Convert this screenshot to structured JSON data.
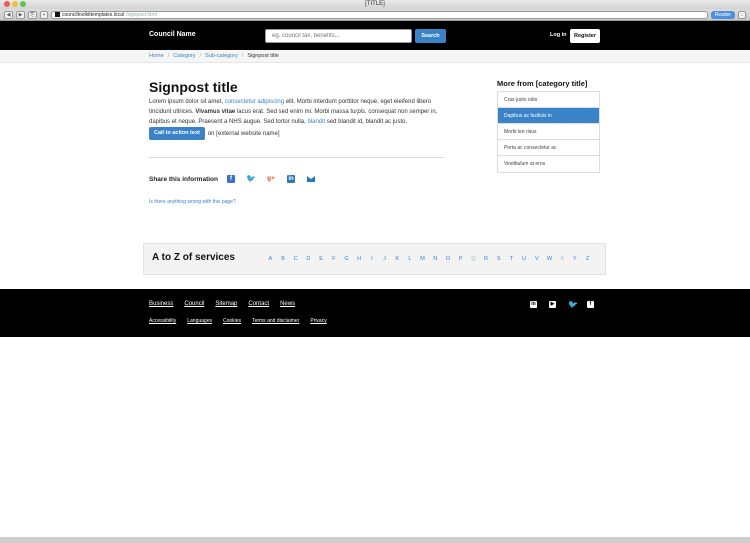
{
  "browser": {
    "window_title": "[TITLE]",
    "url_host": "counciltoolkittemplates.local",
    "url_path": "/signpost.html",
    "reader_label": "Reader",
    "back_glyph": "◀",
    "forward_glyph": "▶",
    "share_glyph": "⎘",
    "plus_glyph": "+",
    "download_glyph": "↓"
  },
  "header": {
    "brand": "Council Name",
    "search_placeholder": "eg. council tax, benefits...",
    "search_button": "Search",
    "login": "Log in",
    "register": "Register"
  },
  "breadcrumb": {
    "items": [
      "Home",
      "Category",
      "Sub-category"
    ],
    "separator": "/",
    "current": "Signpost title"
  },
  "main": {
    "title": "Signpost title",
    "intro": {
      "p1": "Lorem ipsum dolor sit amet, ",
      "link1": "consectetur adipiscing",
      "p2": " elit. Morbi interdum porttitor neque, eget eleifend libero tincidunt ultrices. ",
      "bold": "Vivamus vitae",
      "p3": " lacus erat. Sed sed enim mi. Morbi massa ",
      "italic": "turpis",
      "p4": ", consequat non semper in, dapibus et neque. Praesent a NHS augue. Sed tortor nulla, ",
      "link2": "blandit",
      "p5": " sed blandit id, blandit ac justo."
    },
    "cta_label": "Call to action text",
    "cta_suffix": "on [external website name]",
    "share_label": "Share this information",
    "share_icons": {
      "facebook": "f",
      "twitter": "🐦",
      "googleplus": "g+",
      "linkedin": "in"
    },
    "report_link": "Is there anything wrong with this page?"
  },
  "sidebar": {
    "title": "More from [category title]",
    "items": [
      "Cras justo odio",
      "Dapibus ac facilisis in",
      "Morbi leo risus",
      "Porta ac consectetur ac",
      "Vestibulum at eros"
    ],
    "active_index": 1
  },
  "az": {
    "title": "A to Z of services",
    "letters": [
      "A",
      "B",
      "C",
      "D",
      "E",
      "F",
      "G",
      "H",
      "I",
      "J",
      "K",
      "L",
      "M",
      "N",
      "O",
      "P",
      "Q",
      "R",
      "S",
      "T",
      "U",
      "V",
      "W",
      "X",
      "Y",
      "Z"
    ],
    "muted": [
      "Q",
      "X"
    ]
  },
  "footer": {
    "nav": [
      "Business",
      "Council",
      "Sitemap",
      "Contact",
      "News"
    ],
    "links": [
      "Accessibility",
      "Languages",
      "Cookies",
      "Terms and disclaimer",
      "Privacy"
    ],
    "social": {
      "linkedin": "in",
      "youtube": "▶",
      "twitter": "🐦",
      "facebook": "f"
    }
  },
  "colors": {
    "accent": "#3a83c9",
    "header_bg": "#000000"
  }
}
